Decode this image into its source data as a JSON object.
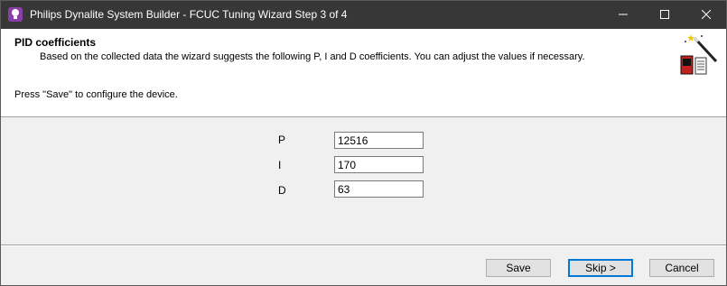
{
  "window": {
    "title": "Philips Dynalite System Builder - FCUC Tuning Wizard Step 3 of 4",
    "icon": "lightbulb-icon",
    "controls": [
      "minimize-icon",
      "maximize-icon",
      "close-icon"
    ]
  },
  "header": {
    "heading": "PID coefficients",
    "description": "Based on the collected data the wizard suggests the following P, I and D coefficients. You can adjust the values if necessary.",
    "instruction": "Press \"Save\" to configure the device.",
    "graphic": "wizard-icon"
  },
  "fields": [
    {
      "label": "P",
      "value": "12516"
    },
    {
      "label": "I",
      "value": "170"
    },
    {
      "label": "D",
      "value": "63"
    }
  ],
  "buttons": {
    "save": "Save",
    "skip": "Skip >",
    "cancel": "Cancel"
  },
  "colors": {
    "titlebar": "#373737",
    "app_icon": "#8a3fa8",
    "focus": "#0078d7"
  }
}
